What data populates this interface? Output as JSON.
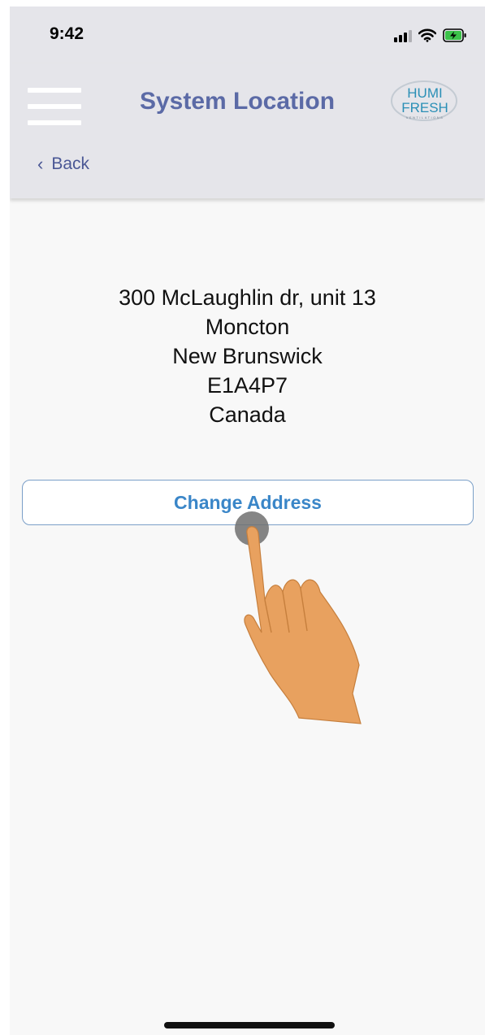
{
  "status_bar": {
    "time": "9:42",
    "icons": [
      "signal-icon",
      "wifi-icon",
      "battery-charging-icon"
    ]
  },
  "header": {
    "title": "System Location",
    "menu_icon": "hamburger-menu-icon",
    "logo": {
      "line1": "HUMI",
      "line2": "FRESH",
      "tagline": "VENTILATIONS"
    },
    "back_label": "Back"
  },
  "address": {
    "street": "300 McLaughlin dr, unit 13",
    "city": "Moncton",
    "province": "New Brunswick",
    "postal_code": "E1A4P7",
    "country": "Canada"
  },
  "actions": {
    "change_address_label": "Change Address"
  },
  "colors": {
    "title": "#5b6aa6",
    "button_text": "#3a86c8",
    "button_border": "#7b9fc8",
    "nav_background": "#e5e5ea",
    "hand": "#e8a15f"
  }
}
